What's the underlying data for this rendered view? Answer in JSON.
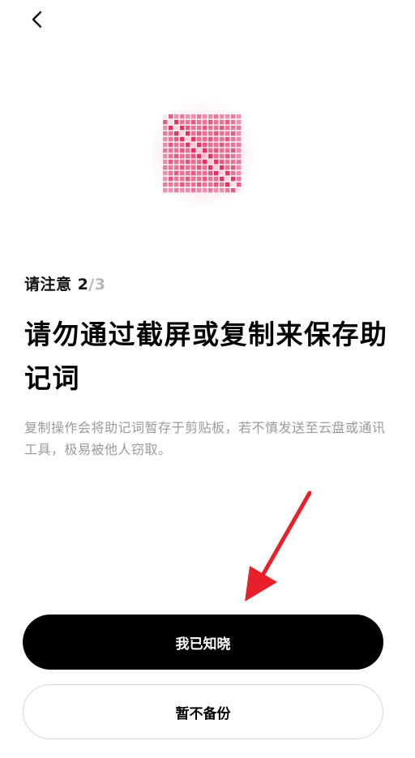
{
  "nav": {
    "back_icon": "chevron-left-icon"
  },
  "illustration": {
    "icon": "no-copy-grid-icon",
    "accent_color": "#e23366"
  },
  "step": {
    "current": "请注意 2",
    "total": "/3"
  },
  "headline": "请勿通过截屏或复制来保存助记词",
  "description": "复制操作会将助记词暂存于剪贴板，若不慎发送至云盘或通讯工具，极易被他人窃取。",
  "buttons": {
    "primary_label": "我已知晓",
    "secondary_label": "暂不备份"
  },
  "annotation": {
    "arrow_color": "#e8202a"
  }
}
